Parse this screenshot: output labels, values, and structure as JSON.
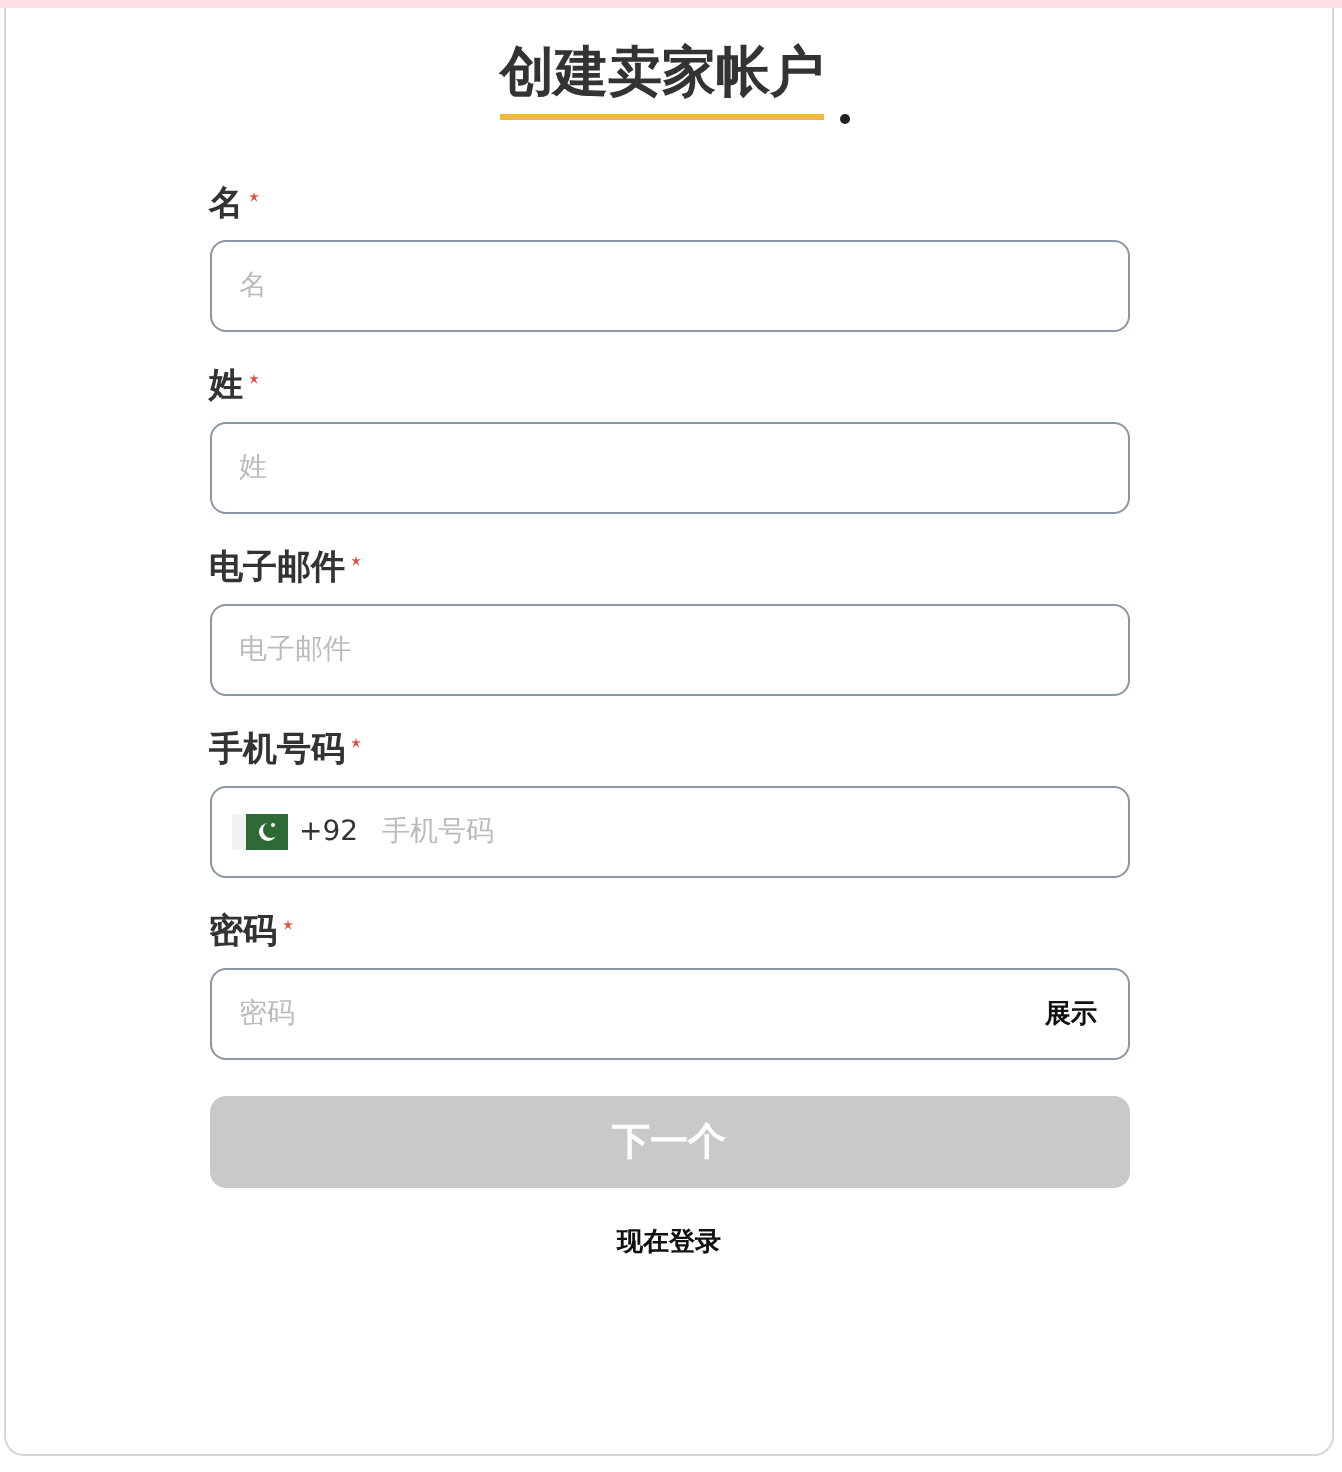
{
  "title": "创建卖家帐户",
  "fields": [
    {
      "kind": "text",
      "label": "名",
      "required": true,
      "placeholder": "名"
    },
    {
      "kind": "text",
      "label": "姓",
      "required": true,
      "placeholder": "姓"
    },
    {
      "kind": "text",
      "label": "电子邮件",
      "required": true,
      "placeholder": "电子邮件"
    },
    {
      "kind": "phone",
      "label": "手机号码",
      "required": true,
      "code": "+92",
      "placeholder": "手机号码"
    },
    {
      "kind": "password",
      "label": "密码",
      "required": true,
      "placeholder": "密码",
      "toggle": "展示"
    }
  ],
  "submit": {
    "label": "下一个",
    "disabled": true
  },
  "login_link": "现在登录"
}
